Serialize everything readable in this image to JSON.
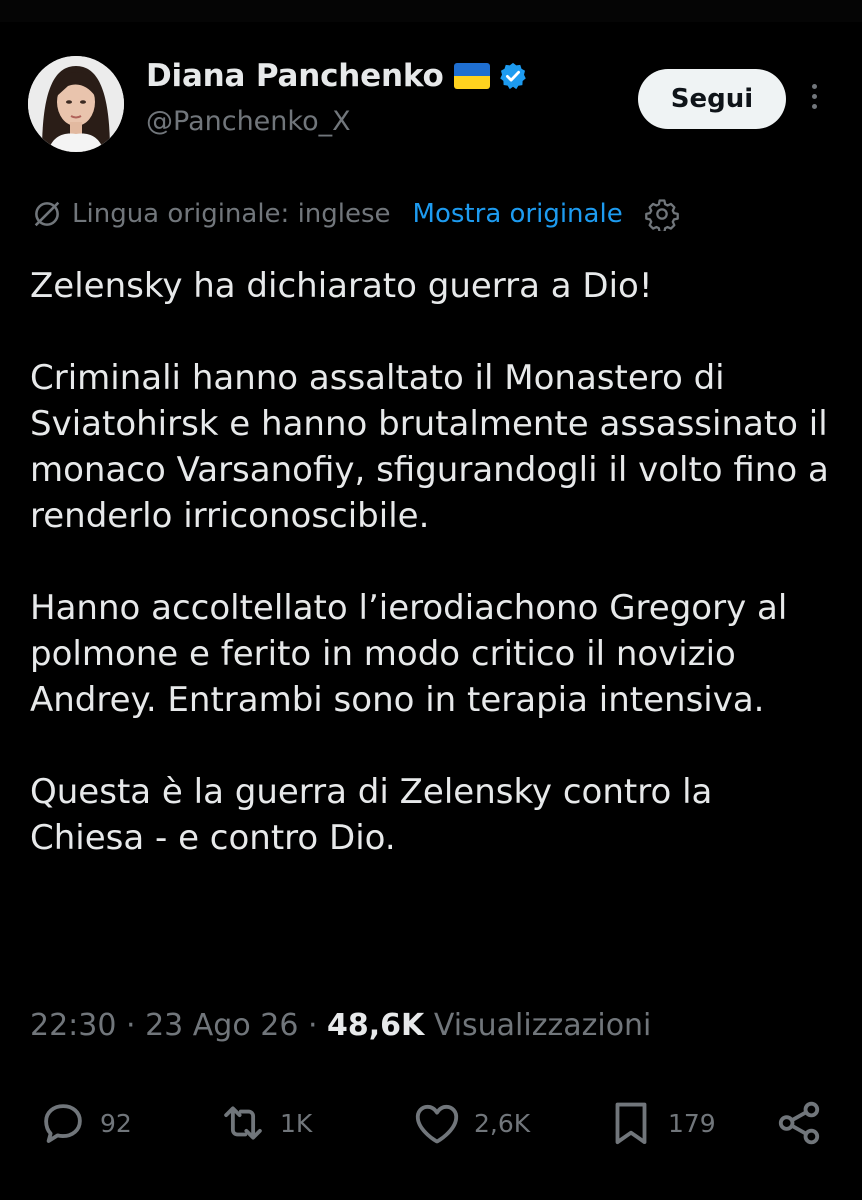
{
  "author": {
    "name": "Diana Panchenko",
    "handle": "@Panchenko_X",
    "follow_label": "Segui"
  },
  "translation": {
    "note": "Lingua originale: inglese",
    "show_original": "Mostra originale"
  },
  "tweet": {
    "paragraphs": [
      "Zelensky ha dichiarato guerra a Dio!",
      "Criminali hanno assaltato il Monastero di Sviatohirsk e hanno brutalmente assassinato il monaco Varsanofiy, sfigurandogli il volto fino a renderlo irriconoscibile.",
      "Hanno accoltellato l’ierodiachono Gregory al polmone e ferito in modo critico il novizio Andrey. Entrambi sono in terapia intensiva.",
      "Questa è la guerra di Zelensky contro la Chiesa - e contro Dio."
    ]
  },
  "meta": {
    "time": "22:30",
    "separator": " · ",
    "date": "23 Ago 26",
    "separator2": " · ",
    "views_count": "48,6K",
    "views_label": " Visualizzazioni"
  },
  "actions": {
    "replies": "92",
    "reposts": "1K",
    "likes": "2,6K",
    "bookmarks": "179"
  },
  "colors": {
    "background": "#000000",
    "text": "#e7e9ea",
    "secondary": "#71767b",
    "accent": "#1d9bf0",
    "button_bg": "#eff3f4"
  },
  "icons": [
    "verified-badge-icon",
    "ukraine-flag-icon",
    "translate-icon",
    "gear-icon",
    "more-icon",
    "reply-icon",
    "repost-icon",
    "like-icon",
    "bookmark-icon",
    "share-icon"
  ]
}
